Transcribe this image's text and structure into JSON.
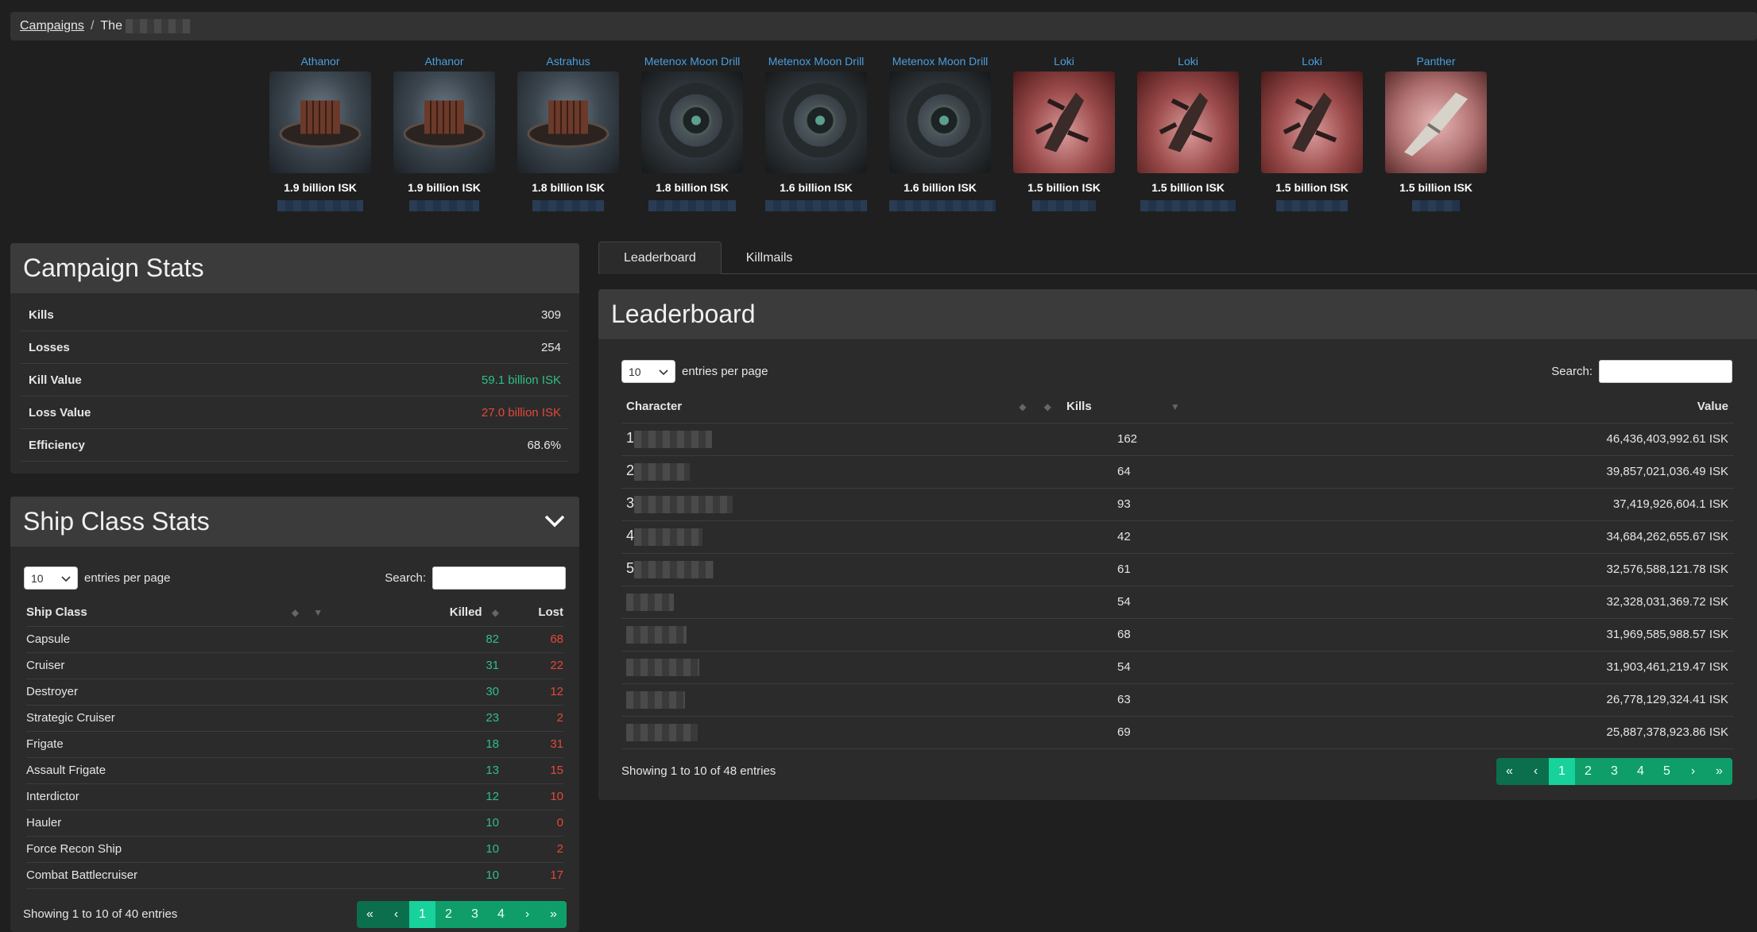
{
  "breadcrumb": {
    "root": "Campaigns",
    "separator": "/",
    "current": "The"
  },
  "ships": [
    {
      "name": "Athanor",
      "value": "1.9 billion ISK",
      "style": "station"
    },
    {
      "name": "Athanor",
      "value": "1.9 billion ISK",
      "style": "station"
    },
    {
      "name": "Astrahus",
      "value": "1.8 billion ISK",
      "style": "station"
    },
    {
      "name": "Metenox Moon Drill",
      "value": "1.8 billion ISK",
      "style": "drill"
    },
    {
      "name": "Metenox Moon Drill",
      "value": "1.6 billion ISK",
      "style": "drill"
    },
    {
      "name": "Metenox Moon Drill",
      "value": "1.6 billion ISK",
      "style": "drill"
    },
    {
      "name": "Loki",
      "value": "1.5 billion ISK",
      "style": "loki"
    },
    {
      "name": "Loki",
      "value": "1.5 billion ISK",
      "style": "loki"
    },
    {
      "name": "Loki",
      "value": "1.5 billion ISK",
      "style": "loki"
    },
    {
      "name": "Panther",
      "value": "1.5 billion ISK",
      "style": "panther"
    }
  ],
  "campaign_stats": {
    "title": "Campaign Stats",
    "rows": [
      {
        "label": "Kills",
        "value": "309",
        "color": ""
      },
      {
        "label": "Losses",
        "value": "254",
        "color": ""
      },
      {
        "label": "Kill Value",
        "value": "59.1 billion ISK",
        "color": "green"
      },
      {
        "label": "Loss Value",
        "value": "27.0 billion ISK",
        "color": "red"
      },
      {
        "label": "Efficiency",
        "value": "68.6%",
        "color": ""
      }
    ]
  },
  "ship_class_stats": {
    "title": "Ship Class Stats",
    "per_page": "10",
    "entries_label": "entries per page",
    "search_label": "Search:",
    "columns": [
      "Ship Class",
      "Killed",
      "Lost"
    ],
    "rows": [
      [
        "Capsule",
        "82",
        "68"
      ],
      [
        "Cruiser",
        "31",
        "22"
      ],
      [
        "Destroyer",
        "30",
        "12"
      ],
      [
        "Strategic Cruiser",
        "23",
        "2"
      ],
      [
        "Frigate",
        "18",
        "31"
      ],
      [
        "Assault Frigate",
        "13",
        "15"
      ],
      [
        "Interdictor",
        "12",
        "10"
      ],
      [
        "Hauler",
        "10",
        "0"
      ],
      [
        "Force Recon Ship",
        "10",
        "2"
      ],
      [
        "Combat Battlecruiser",
        "10",
        "17"
      ]
    ],
    "info": "Showing 1 to 10 of 40 entries",
    "pages": [
      "«",
      "‹",
      "1",
      "2",
      "3",
      "4",
      "›",
      "»"
    ],
    "active_page": "1"
  },
  "tabs": [
    "Leaderboard",
    "Killmails"
  ],
  "active_tab": "Leaderboard",
  "leaderboard": {
    "title": "Leaderboard",
    "per_page": "10",
    "entries_label": "entries per page",
    "search_label": "Search:",
    "columns": [
      "Character",
      "Kills",
      "Value"
    ],
    "rows": [
      {
        "rank": "1",
        "kills": "162",
        "value": "46,436,403,992.61 ISK"
      },
      {
        "rank": "2",
        "kills": "64",
        "value": "39,857,021,036.49 ISK"
      },
      {
        "rank": "3",
        "kills": "93",
        "value": "37,419,926,604.1 ISK"
      },
      {
        "rank": "4",
        "kills": "42",
        "value": "34,684,262,655.67 ISK"
      },
      {
        "rank": "5",
        "kills": "61",
        "value": "32,576,588,121.78 ISK"
      },
      {
        "rank": "",
        "kills": "54",
        "value": "32,328,031,369.72 ISK"
      },
      {
        "rank": "",
        "kills": "68",
        "value": "31,969,585,988.57 ISK"
      },
      {
        "rank": "",
        "kills": "54",
        "value": "31,903,461,219.47 ISK"
      },
      {
        "rank": "",
        "kills": "63",
        "value": "26,778,129,324.41 ISK"
      },
      {
        "rank": "",
        "kills": "69",
        "value": "25,887,378,923.86 ISK"
      }
    ],
    "info": "Showing 1 to 10 of 48 entries",
    "pages": [
      "«",
      "‹",
      "1",
      "2",
      "3",
      "4",
      "5",
      "›",
      "»"
    ],
    "active_page": "1"
  },
  "colors": {
    "green": "#2fbf87",
    "red": "#e3483a",
    "pager": "#0f9e6a",
    "pager_active": "#17d29a",
    "link": "#4a9fe0"
  }
}
